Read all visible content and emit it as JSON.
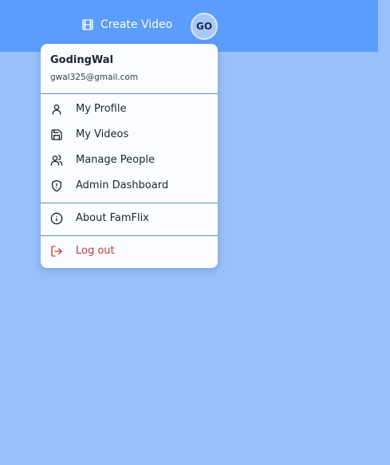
{
  "header": {
    "create_video": {
      "label": "Create Video",
      "icon": "film-icon"
    },
    "avatar_initials": "GO"
  },
  "menu": {
    "user": {
      "name": "GodingWal",
      "email": "gwal325@gmail.com"
    },
    "sections": [
      [
        {
          "label": "My Profile",
          "icon": "user-icon"
        },
        {
          "label": "My Videos",
          "icon": "save-icon"
        },
        {
          "label": "Manage People",
          "icon": "users-icon"
        },
        {
          "label": "Admin Dashboard",
          "icon": "shield-alert-icon"
        }
      ],
      [
        {
          "label": "About FamFlix",
          "icon": "info-icon"
        }
      ],
      [
        {
          "label": "Log out",
          "icon": "log-out-icon",
          "color": "#d93535"
        }
      ]
    ]
  },
  "colors": {
    "background": "#98c0fc",
    "header": "#5b9dfd",
    "menu_background": "#fafcff",
    "danger": "#d93535"
  }
}
